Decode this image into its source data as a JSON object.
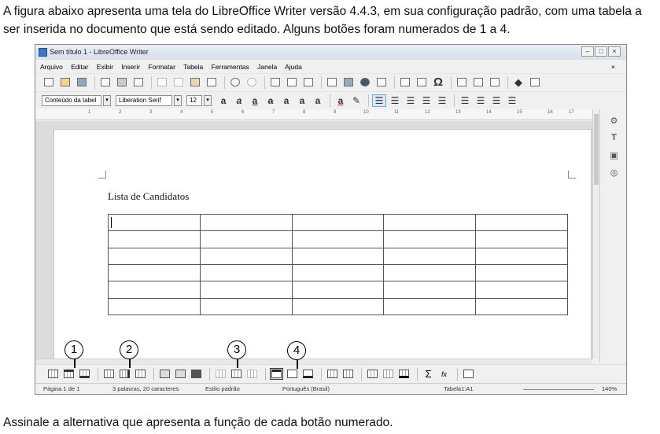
{
  "question": {
    "intro": "A figura abaixo apresenta uma tela do LibreOffice Writer versão 4.4.3, em sua configuração padrão, com uma tabela a ser inserida no documento que está sendo editado. Alguns botões foram numerados de 1 a 4.",
    "prompt": "Assinale a alternativa que apresenta a função de cada botão numerado."
  },
  "window": {
    "title": "Sem título 1 - LibreOffice Writer",
    "controls": [
      "–",
      "□",
      "×"
    ]
  },
  "menu": {
    "items": [
      "Arquivo",
      "Editar",
      "Exibir",
      "Inserir",
      "Formatar",
      "Tabela",
      "Ferramentas",
      "Janela",
      "Ajuda"
    ],
    "close": "×"
  },
  "format_toolbar": {
    "paragraph_style": "Conteúdo da tabel",
    "font_name": "Liberation Serif",
    "font_size": "12"
  },
  "ruler": {
    "ticks": [
      "1",
      "2",
      "3",
      "4",
      "5",
      "6",
      "7",
      "8",
      "9",
      "10",
      "11",
      "12",
      "13",
      "14",
      "15",
      "16",
      "17"
    ]
  },
  "document": {
    "heading": "Lista de Candidatos",
    "table": {
      "rows": 6,
      "cols": 5
    }
  },
  "annotations": [
    "1",
    "2",
    "3",
    "4"
  ],
  "status": {
    "page": "Página 1 de 1",
    "words": "3 palavras, 20 caracteres",
    "style": "Estilo padrão",
    "language": "Português (Brasil)",
    "cell": "Tabela1:A1",
    "zoom": "140%"
  },
  "icons": {
    "sidebar": [
      "properties-icon",
      "styles-icon",
      "gallery-icon",
      "navigator-icon"
    ]
  }
}
